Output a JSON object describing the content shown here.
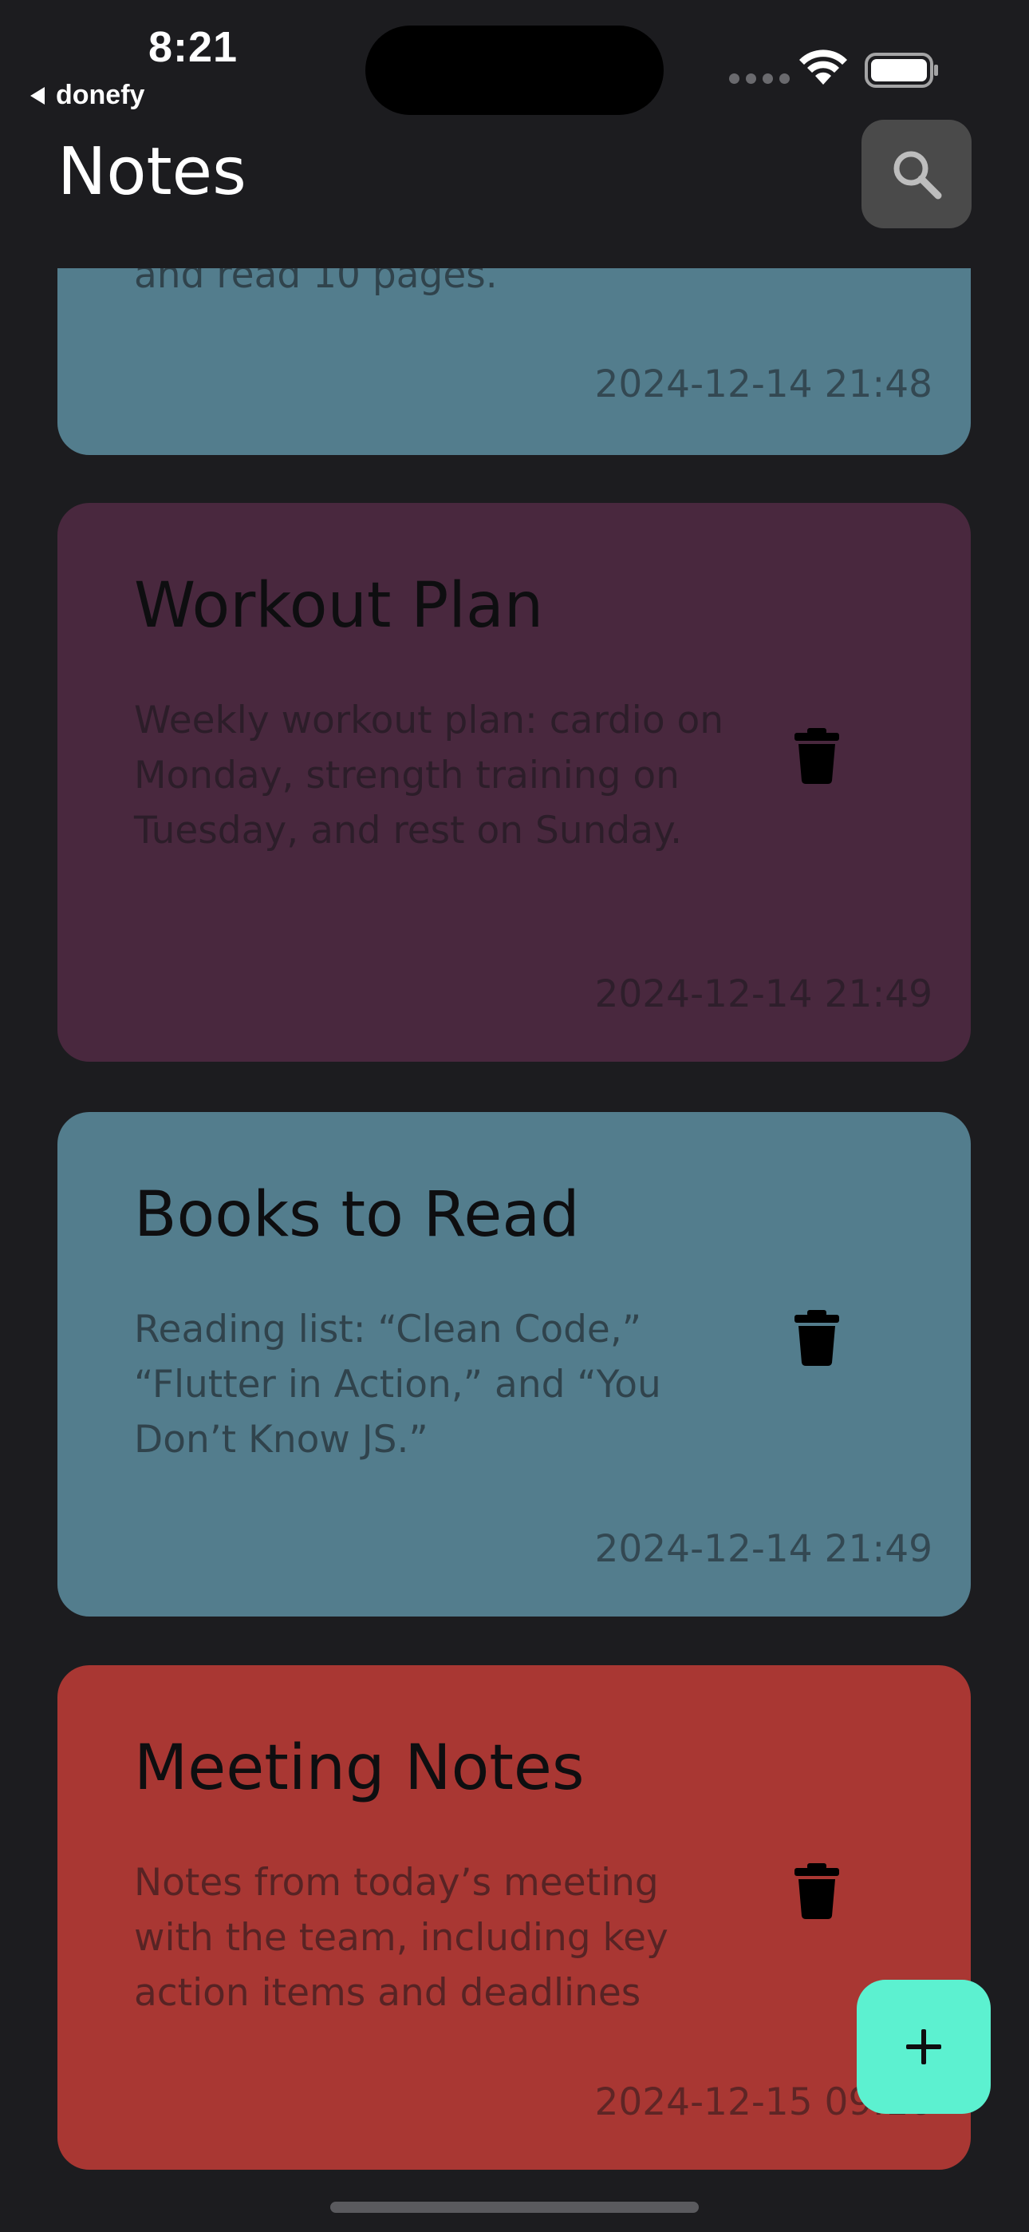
{
  "status_bar": {
    "time": "8:21",
    "back_app": "donefy"
  },
  "header": {
    "title": "Notes",
    "search_icon": "search-icon"
  },
  "notes": [
    {
      "title": "",
      "body": "and read 10 pages.",
      "date": "2024-12-14 21:48",
      "color": "#537d8d"
    },
    {
      "title": "Workout Plan",
      "body": "Weekly workout plan: cardio on Monday, strength training on Tuesday, and rest on Sunday.",
      "date": "2024-12-14 21:49",
      "color": "#49283e"
    },
    {
      "title": "Books to Read",
      "body": "Reading list: “Clean Code,” “Flutter in Action,” and “You Don’t Know JS.”",
      "date": "2024-12-14 21:49",
      "color": "#537d8d"
    },
    {
      "title": "Meeting Notes",
      "body": "Notes from today’s meeting with the team, including key action items and deadlines",
      "date": "2024-12-15 09:16",
      "color": "#a93733"
    }
  ],
  "fab": {
    "icon": "plus-icon",
    "color": "#5cf1d0"
  }
}
